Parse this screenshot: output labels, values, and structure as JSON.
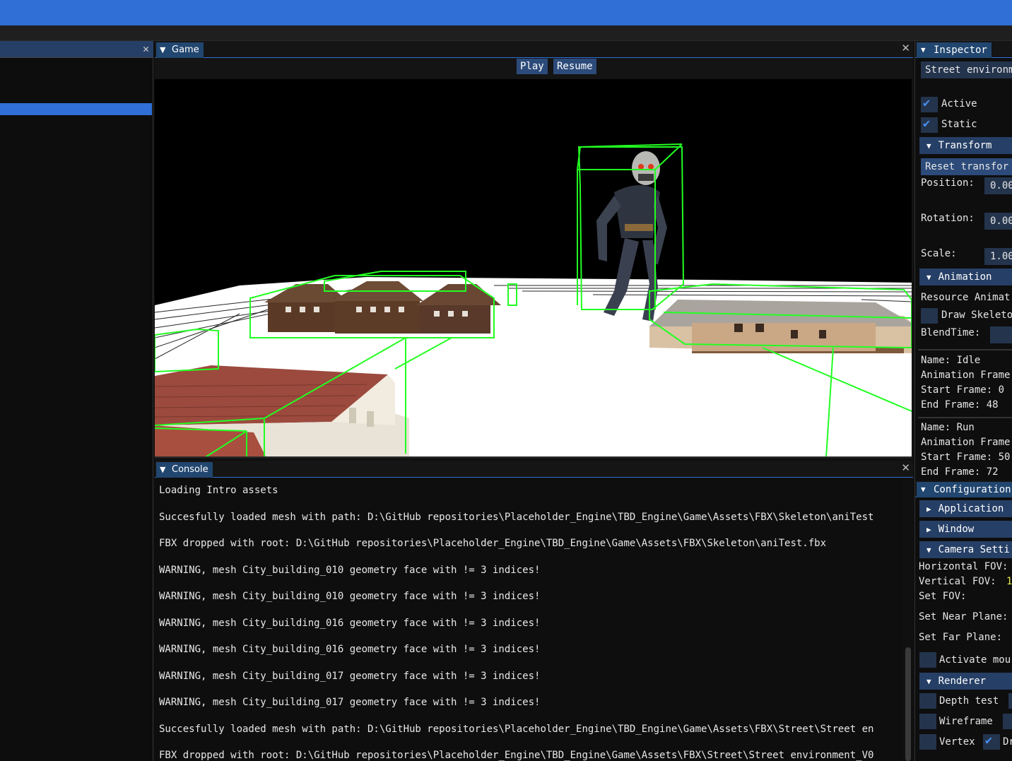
{
  "game": {
    "tab": "Game",
    "play": "Play",
    "resume": "Resume"
  },
  "console": {
    "tab": "Console",
    "lines": [
      "Loading Intro assets",
      "Succesfully loaded mesh with path: D:\\GitHub repositories\\Placeholder_Engine\\TBD_Engine\\Game\\Assets\\FBX\\Skeleton\\aniTest",
      "FBX dropped with root: D:\\GitHub repositories\\Placeholder_Engine\\TBD_Engine\\Game\\Assets\\FBX\\Skeleton\\aniTest.fbx",
      "WARNING, mesh City_building_010 geometry face with != 3 indices!",
      "WARNING, mesh City_building_010 geometry face with != 3 indices!",
      "WARNING, mesh City_building_016 geometry face with != 3 indices!",
      "WARNING, mesh City_building_016 geometry face with != 3 indices!",
      "WARNING, mesh City_building_017 geometry face with != 3 indices!",
      "WARNING, mesh City_building_017 geometry face with != 3 indices!",
      "Succesfully loaded mesh with path: D:\\GitHub repositories\\Placeholder_Engine\\TBD_Engine\\Game\\Assets\\FBX\\Street\\Street en",
      "FBX dropped with root: D:\\GitHub repositories\\Placeholder_Engine\\TBD_Engine\\Game\\Assets\\FBX\\Street\\Street environment_V0"
    ]
  },
  "inspector": {
    "tab": "Inspector",
    "object_name": "Street environm",
    "active_label": "Active",
    "active_checked": true,
    "static_label": "Static",
    "static_checked": true,
    "transform_header": "Transform",
    "reset_transform": "Reset transfor",
    "position_label": "Position:",
    "position_x": "0.00",
    "rotation_label": "Rotation:",
    "rotation_x": "0.00",
    "scale_label": "Scale:",
    "scale_x": "1.00",
    "animation_header": "Animation",
    "resource_animation": "Resource Animat",
    "draw_skeleton": "Draw Skeleto",
    "blend_time": "BlendTime:",
    "anim1_name": "Name: Idle",
    "anim1_frames": "Animation Frame",
    "anim1_start": "Start Frame: 0",
    "anim1_end": "End Frame: 48",
    "anim2_name": "Name: Run",
    "anim2_frames": "Animation Frame",
    "anim2_start": "Start Frame: 50",
    "anim2_end": "End Frame: 72"
  },
  "configuration": {
    "tab": "Configuration",
    "application": "Application",
    "window": "Window",
    "camera_settings": "Camera Setti",
    "horizontal_fov": "Horizontal FOV:",
    "vertical_fov": "Vertical FOV:",
    "vertical_fov_value": "1",
    "set_fov": "Set FOV:",
    "set_near": "Set Near Plane:",
    "set_far": "Set Far Plane:",
    "activate_mouse": "Activate mou",
    "renderer": "Renderer",
    "depth_test": "Depth test",
    "wireframe": "Wireframe",
    "vertex": "Vertex",
    "vertex_right": "Dr"
  },
  "colors": {
    "accent": "#2f6fd6",
    "tab_bg": "#21466f",
    "bounding_box": "#22ff22"
  }
}
